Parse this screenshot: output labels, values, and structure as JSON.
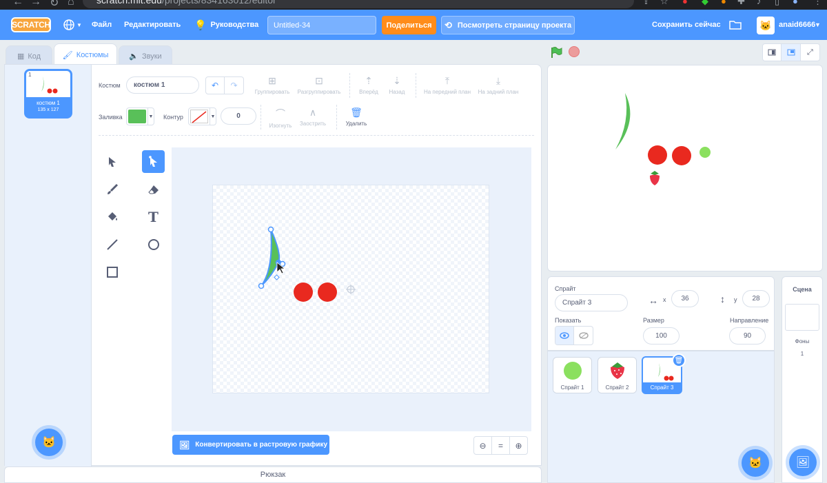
{
  "browser": {
    "url_host": "scratch.mit.edu",
    "url_path": "/projects/834163012/editor"
  },
  "menu": {
    "logo": "SCRATCH",
    "file": "Файл",
    "edit": "Редактировать",
    "tutorials": "Руководства",
    "project_title": "Untitled-34",
    "share": "Поделиться",
    "see_project": "Посмотреть страницу проекта",
    "save_now": "Сохранить сейчас",
    "username": "anaid6666"
  },
  "tabs": {
    "code": "Код",
    "costumes": "Костюмы",
    "sounds": "Звуки"
  },
  "costume_list": [
    {
      "number": "1",
      "name": "костюм 1",
      "size": "135 x 127"
    }
  ],
  "paint": {
    "costume_label": "Костюм",
    "costume_name": "костюм 1",
    "group": "Группировать",
    "ungroup": "Разгруппировать",
    "forward": "Вперёд",
    "backward": "Назад",
    "front": "На передний план",
    "back": "На задний план",
    "fill_label": "Заливка",
    "outline_label": "Контур",
    "outline_width": "0",
    "curved": "Изогнуть",
    "pointed": "Заострить",
    "delete": "Удалить",
    "convert_bitmap": "Конвертировать в растровую графику",
    "fill_color": "#59c059",
    "zoom_reset": "="
  },
  "backpack": "Рюкзак",
  "sprite_info": {
    "sprite_label": "Спрайт",
    "sprite_name": "Спрайт 3",
    "x_label": "x",
    "x": "36",
    "y_label": "y",
    "y": "28",
    "show_label": "Показать",
    "size_label": "Размер",
    "size": "100",
    "direction_label": "Направление",
    "direction": "90"
  },
  "sprites": [
    {
      "name": "Спрайт 1"
    },
    {
      "name": "Спрайт 2"
    },
    {
      "name": "Спрайт 3",
      "selected": true
    }
  ],
  "stage_panel": {
    "title": "Сцена",
    "backdrops_label": "Фоны",
    "backdrops_count": "1"
  },
  "colors": {
    "blue": "#4c97ff",
    "orange": "#ff8c1a",
    "green": "#59c059",
    "red": "#e9291f"
  }
}
